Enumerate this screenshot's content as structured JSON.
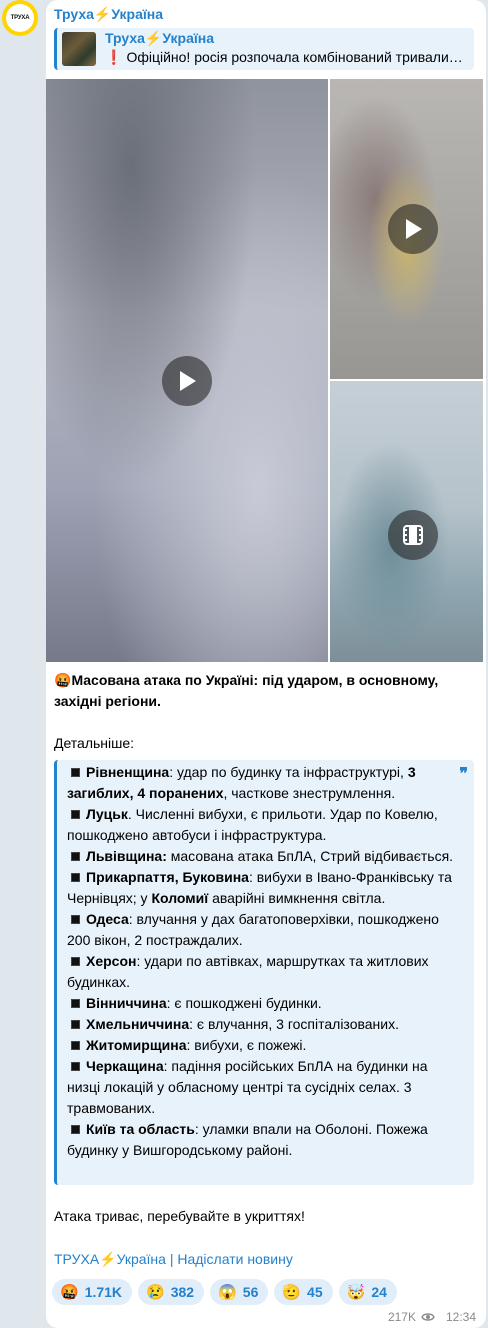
{
  "channel": {
    "name": "Труха⚡Україна",
    "avatar_text": "ТРУХА"
  },
  "reply": {
    "title": "Труха⚡Україна",
    "icon": "exclamation-icon",
    "text": "Офіційно! росія розпочала комбінований тривали…"
  },
  "media": {
    "tiles": [
      {
        "type": "video",
        "icon": "play-icon"
      },
      {
        "type": "video",
        "icon": "play-icon"
      },
      {
        "type": "video",
        "icon": "film-icon"
      }
    ]
  },
  "post": {
    "headline_emoji": "🤬",
    "headline": "Масована атака по Україні: під ударом, в основному, західні регіони.",
    "details_label": "Детальніше:",
    "quote_items": [
      {
        "parts": [
          {
            "t": "Рівненщина",
            "b": true
          },
          {
            "t": ": удар по будинку та інфраструктурі, ",
            "b": false
          },
          {
            "t": "3 загиблих, 4 поранених",
            "b": true
          },
          {
            "t": ", часткове знеструмлення.",
            "b": false
          }
        ]
      },
      {
        "parts": [
          {
            "t": "Луцьк",
            "b": true
          },
          {
            "t": ". Численні вибухи, є прильоти. Удар по Ковелю, пошкоджено автобуси і інфраструктура.",
            "b": false
          }
        ]
      },
      {
        "parts": [
          {
            "t": "Львівщина:",
            "b": true
          },
          {
            "t": " масована атака БпЛА, Стрий відбивається.",
            "b": false
          }
        ]
      },
      {
        "parts": [
          {
            "t": "Прикарпаття, Буковина",
            "b": true
          },
          {
            "t": ": вибухи в Івано-Франківську та Чернівцях; у ",
            "b": false
          },
          {
            "t": "Коломиї",
            "b": true
          },
          {
            "t": " аварійні вимкнення світла.",
            "b": false
          }
        ]
      },
      {
        "parts": [
          {
            "t": "Одеса",
            "b": true
          },
          {
            "t": ": влучання у дах багатоповерхівки, пошкоджено 200 вікон, 2 постраждалих.",
            "b": false
          }
        ]
      },
      {
        "parts": [
          {
            "t": "Херсон",
            "b": true
          },
          {
            "t": ": удари по автівках, маршрутках та житлових будинках.",
            "b": false
          }
        ]
      },
      {
        "parts": [
          {
            "t": "Вінниччина",
            "b": true
          },
          {
            "t": ": є пошкоджені будинки.",
            "b": false
          }
        ]
      },
      {
        "parts": [
          {
            "t": "Хмельниччина",
            "b": true
          },
          {
            "t": ": є влучання, 3 госпіталізованих.",
            "b": false
          }
        ]
      },
      {
        "parts": [
          {
            "t": "Житомирщина",
            "b": true
          },
          {
            "t": ": вибухи, є пожежі.",
            "b": false
          }
        ]
      },
      {
        "parts": [
          {
            "t": "Черкащина",
            "b": true
          },
          {
            "t": ": падіння російських БпЛА на будинки на низці локацій у обласному центрі та сусідніх селах. 3 травмованих.",
            "b": false
          }
        ]
      },
      {
        "parts": [
          {
            "t": "Київ та область",
            "b": true
          },
          {
            "t": ": уламки впали на Оболоні. Пожежа будинку у Вишгородському районі.",
            "b": false
          }
        ]
      }
    ],
    "closing": "Атака триває, перебувайте в укриттях!",
    "signature": "ТРУХА⚡Україна | Надіслати новину"
  },
  "reactions": [
    {
      "emoji": "🤬",
      "count": "1.71K"
    },
    {
      "emoji": "😢",
      "count": "382"
    },
    {
      "emoji": "😱",
      "count": "56"
    },
    {
      "emoji": "🫡",
      "count": "45"
    },
    {
      "emoji": "🤯",
      "count": "24"
    }
  ],
  "meta": {
    "views": "217K",
    "views_icon": "eye-icon",
    "time": "12:34"
  },
  "colors": {
    "accent": "#2481cc",
    "quote_bg": "#e8f2fb",
    "reaction_bg": "#e1eefa",
    "avatar_ring": "#ffd400"
  }
}
